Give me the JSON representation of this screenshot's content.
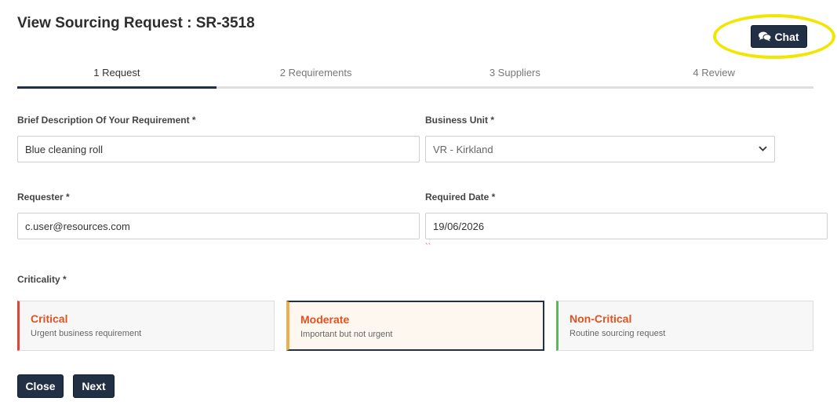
{
  "page": {
    "title": "View Sourcing Request : SR-3518"
  },
  "chat": {
    "label": "Chat",
    "icon": "comments-icon",
    "highlight_color": "#f2e600"
  },
  "tabs": [
    {
      "label": "1 Request",
      "active": true
    },
    {
      "label": "2 Requirements",
      "active": false
    },
    {
      "label": "3 Suppliers",
      "active": false
    },
    {
      "label": "4 Review",
      "active": false
    }
  ],
  "form": {
    "description": {
      "label": "Brief Description Of Your Requirement *",
      "value": "Blue cleaning roll"
    },
    "business_unit": {
      "label": "Business Unit *",
      "value": "VR - Kirkland"
    },
    "requester": {
      "label": "Requester *",
      "value": "c.user@resources.com"
    },
    "required_date": {
      "label": "Required Date *",
      "value": "19/06/2026",
      "error_mark": "``"
    },
    "criticality": {
      "label": "Criticality *",
      "selected": "Moderate",
      "options": [
        {
          "name": "Critical",
          "desc": "Urgent business requirement",
          "color": "#d9473a"
        },
        {
          "name": "Moderate",
          "desc": "Important but not urgent",
          "color": "#f0ad4e"
        },
        {
          "name": "Non-Critical",
          "desc": "Routine sourcing request",
          "color": "#5cb85c"
        }
      ]
    }
  },
  "actions": {
    "close": "Close",
    "next": "Next"
  },
  "colors": {
    "primary": "#223046",
    "accent_text": "#e0521f"
  }
}
